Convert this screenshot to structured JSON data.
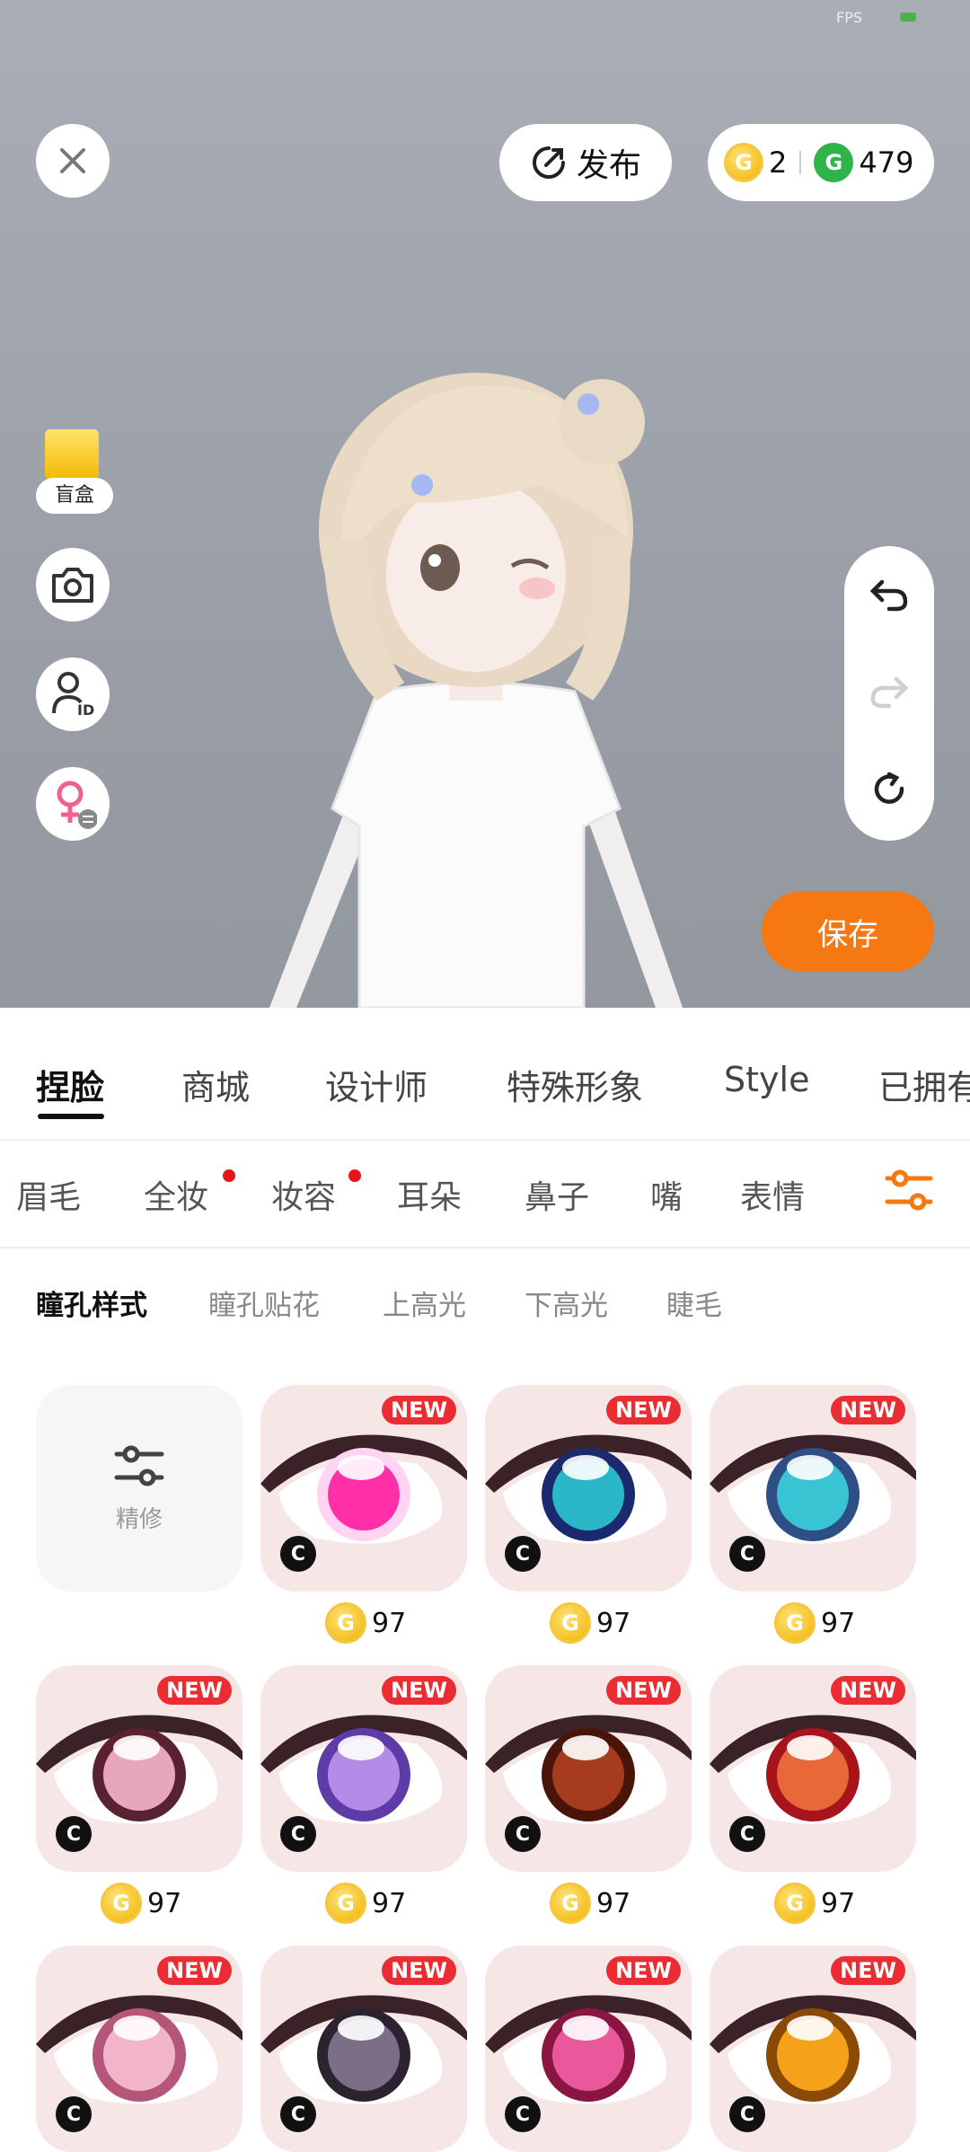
{
  "status": {
    "fps": "FPS"
  },
  "header": {
    "publish_label": "发布",
    "gold_amount": "2",
    "green_amount": "479",
    "save_label": "保存"
  },
  "left_tools": {
    "blind_box_label": "盲盒"
  },
  "main_tabs": [
    "捏脸",
    "商城",
    "设计师",
    "特殊形象",
    "Style",
    "已拥有"
  ],
  "sub_tabs": [
    "眉毛",
    "全妆",
    "妆容",
    "耳朵",
    "鼻子",
    "嘴",
    "表情"
  ],
  "eye_options": [
    "瞳孔样式",
    "瞳孔贴花",
    "上高光",
    "下高光",
    "睫毛"
  ],
  "custom_card_label": "精修",
  "badges": {
    "new": "NEW",
    "c": "C",
    "coin_letter": "G"
  },
  "items": [
    {
      "price": "97",
      "iris": "#ff2fa8",
      "iris2": "#ffd3f2"
    },
    {
      "price": "97",
      "iris": "#2ab7c8",
      "iris2": "#1b2a6e"
    },
    {
      "price": "97",
      "iris": "#39c4d4",
      "iris2": "#2e4e86"
    },
    {
      "price": "97",
      "iris": "#e7a6be",
      "iris2": "#5a2230"
    },
    {
      "price": "97",
      "iris": "#b58be8",
      "iris2": "#5f3ba8"
    },
    {
      "price": "97",
      "iris": "#a63c1d",
      "iris2": "#4a1509"
    },
    {
      "price": "97",
      "iris": "#e8683a",
      "iris2": "#a8141c"
    },
    {
      "price": "",
      "iris": "#f1b4c8",
      "iris2": "#b55579"
    },
    {
      "price": "",
      "iris": "#7a6f86",
      "iris2": "#2b2430"
    },
    {
      "price": "",
      "iris": "#e8589a",
      "iris2": "#8a1540"
    },
    {
      "price": "",
      "iris": "#f5a21b",
      "iris2": "#8a4a06"
    }
  ],
  "colors": {
    "accent": "#f57812",
    "new_badge": "#ea2c33",
    "dot": "#e8131b"
  }
}
